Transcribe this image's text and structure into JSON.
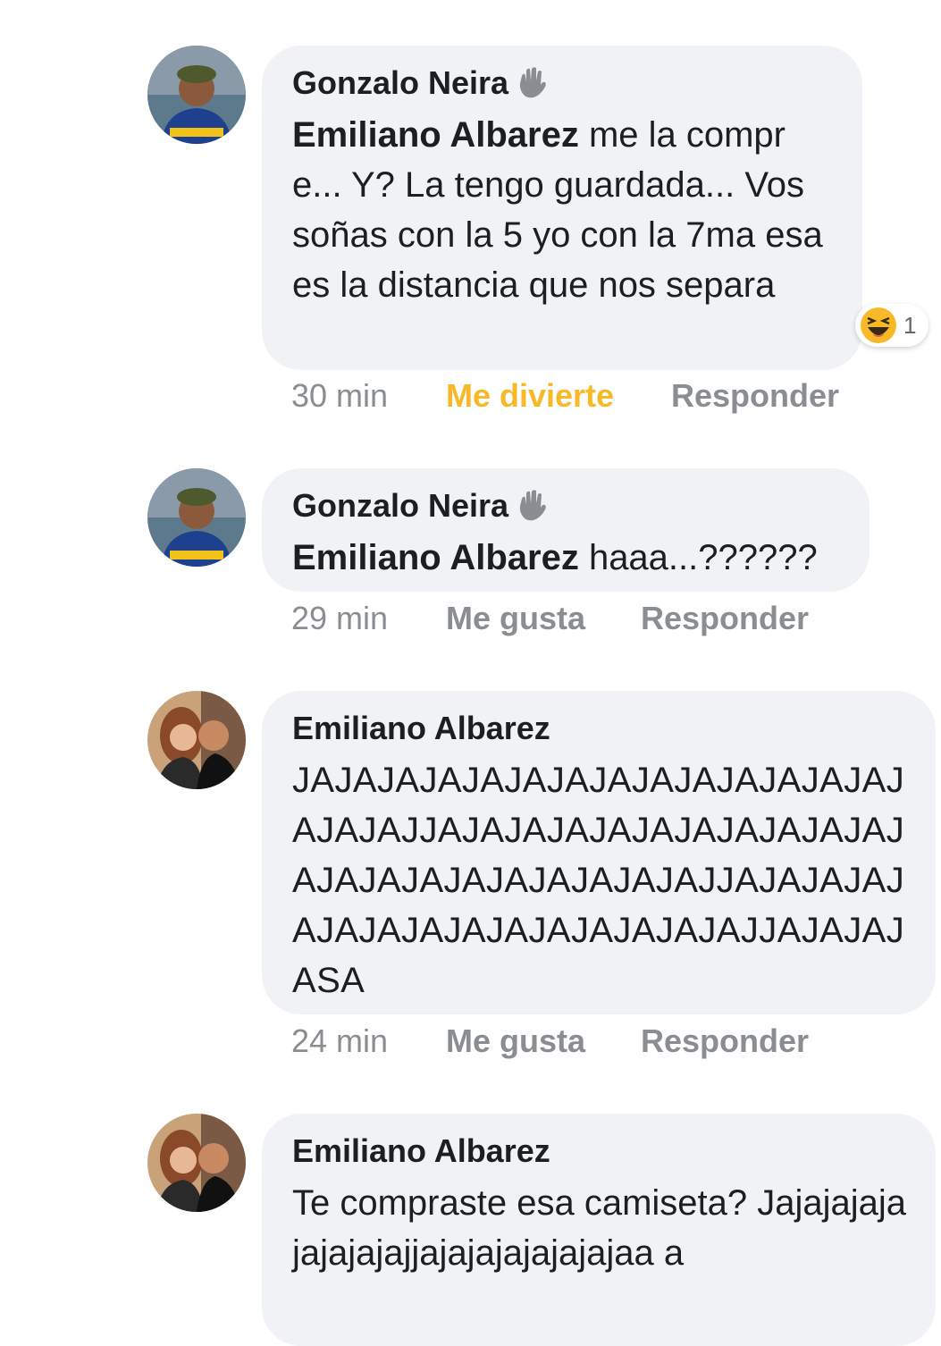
{
  "comments": [
    {
      "author": "Gonzalo Neira",
      "mention": "Emiliano Albarez",
      "text": " me la compre... Y? La tengo guardada... Vos soñas con la 5 yo con la 7ma esa es la distancia que nos separa",
      "time": "30 min",
      "reaction_label": "Me divierte",
      "reply_label": "Responder",
      "reaction_count": "1",
      "reaction_icon": "laughing-emoji-icon",
      "badge_icon": "waving-hand-icon"
    },
    {
      "author": "Gonzalo Neira",
      "mention": "Emiliano Albarez",
      "text": " haaa...??????",
      "time": "29 min",
      "reaction_label": "Me gusta",
      "reply_label": "Responder",
      "badge_icon": "waving-hand-icon"
    },
    {
      "author": "Emiliano Albarez",
      "text": "JAJAJAJAJAJAJAJAJAJAJAJAJAJAJAJAJAJJAJAJAJAJAJAJAJAJAJAJAJAJAJAJAJAJAJAJAJAJAJJAJAJAJAJAJAJAJAJAJAJAJAJAJAJAJJAJAJAJASA",
      "time": "24 min",
      "reaction_label": "Me gusta",
      "reply_label": "Responder"
    },
    {
      "author": "Emiliano Albarez",
      "text": "Te compraste esa camiseta? Jajajajajajajajajajjajajajajajajajaa a"
    }
  ],
  "colors": {
    "bubble": "#f0f2f5",
    "reaction_active": "#f7b928",
    "meta": "#8a8d91"
  }
}
